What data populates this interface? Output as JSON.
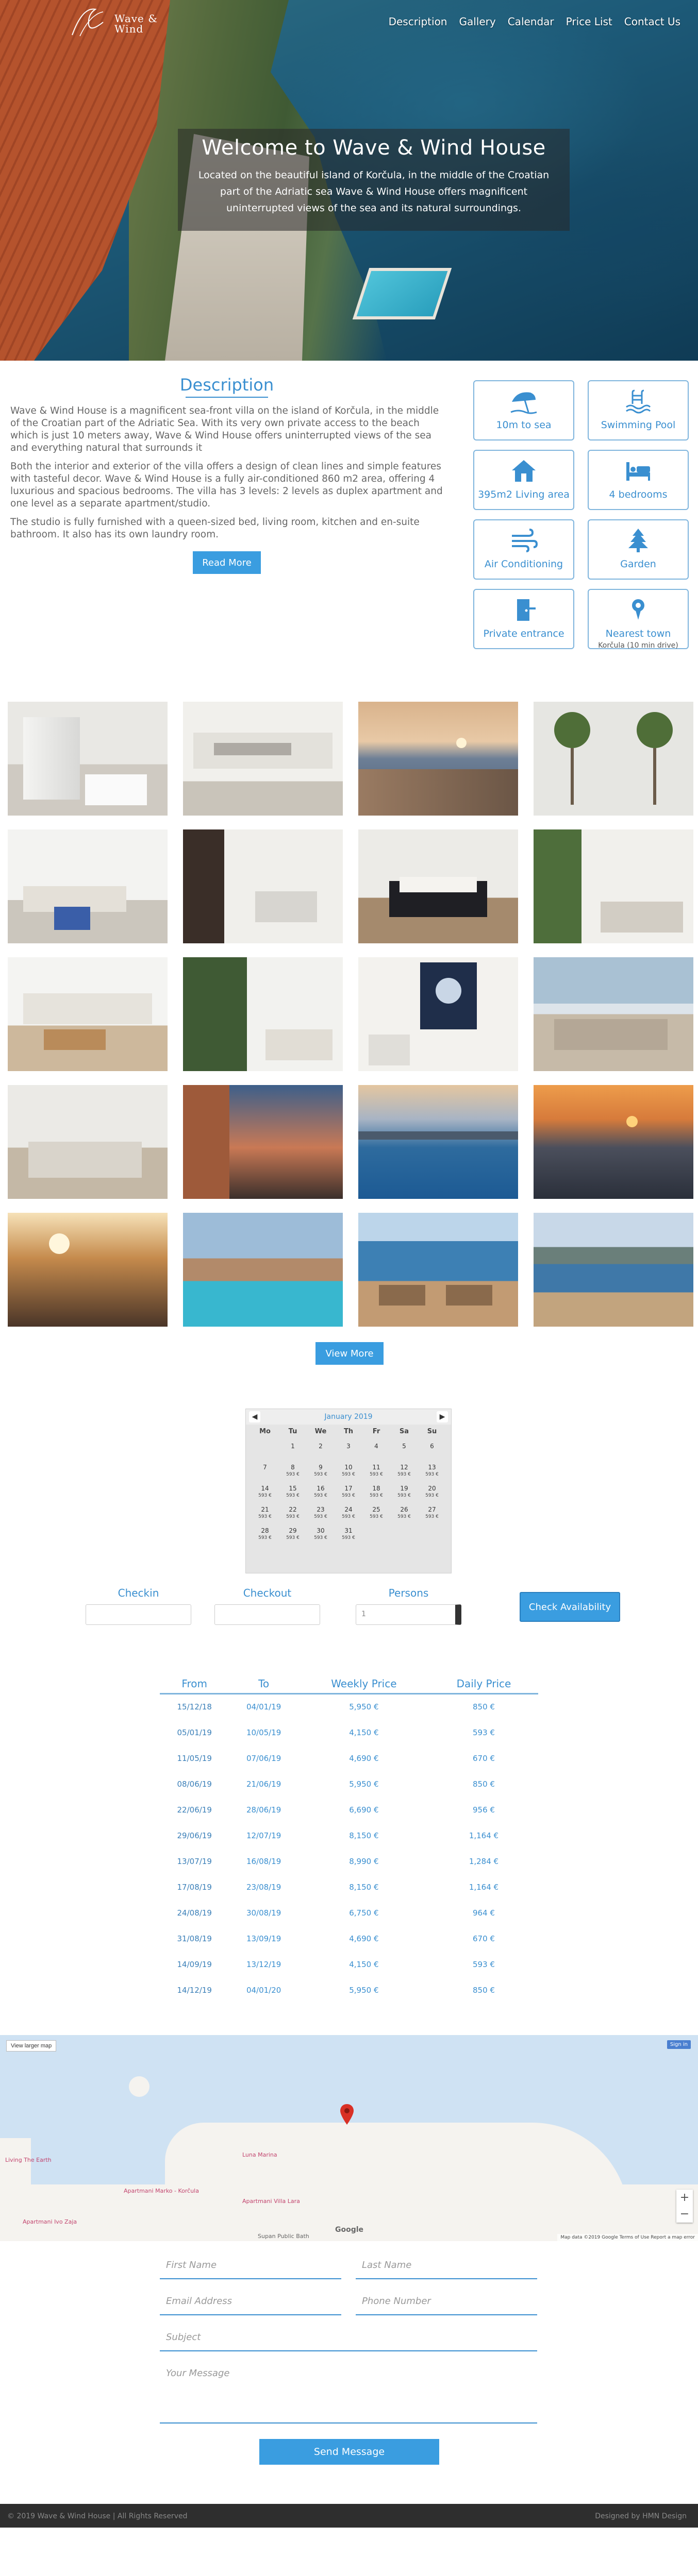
{
  "nav": {
    "logo_text_line1": "Wave &",
    "logo_text_line2": "Wind",
    "links": [
      "Description",
      "Gallery",
      "Calendar",
      "Price List",
      "Contact Us"
    ]
  },
  "hero": {
    "title": "Welcome to Wave & Wind House",
    "text": "Located on the beautiful island of Korčula, in the middle of the Croatian part of the Adriatic sea Wave & Wind House offers magnificent uninterrupted views of the sea and its natural surroundings."
  },
  "description": {
    "heading": "Description",
    "paragraphs": [
      "Wave & Wind House is a magnificent sea-front villa on the island of Korčula, in the middle of the Croatian part of the Adriatic Sea. With its very own private access to the beach which is just 10 meters away, Wave & Wind House offers uninterrupted views of the sea and everything natural that surrounds it",
      "Both the interior and exterior of the villa offers a design of clean lines and simple features with tasteful decor. Wave & Wind House is a fully air-conditioned 860 m2 area, offering 4 luxurious and spacious bedrooms. The villa has 3 levels: 2 levels as duplex apartment and one level as a separate apartment/studio.",
      "The studio is fully furnished with a queen-sized bed, living room, kitchen and en-suite bathroom. It also has its own laundry room."
    ],
    "read_more": "Read More"
  },
  "features": [
    {
      "icon": "umbrella-icon",
      "label": "10m to sea",
      "sub": ""
    },
    {
      "icon": "swimming-pool-icon",
      "label": "Swimming Pool",
      "sub": ""
    },
    {
      "icon": "house-icon",
      "label": "395m2 Living area",
      "sub": ""
    },
    {
      "icon": "bed-icon",
      "label": "4 bedrooms",
      "sub": ""
    },
    {
      "icon": "wind-icon",
      "label": "Air Conditioning",
      "sub": ""
    },
    {
      "icon": "tree-icon",
      "label": "Garden",
      "sub": ""
    },
    {
      "icon": "door-icon",
      "label": "Private entrance",
      "sub": ""
    },
    {
      "icon": "location-pin-icon",
      "label": "Nearest town",
      "sub": "Korčula (10 min drive)"
    }
  ],
  "gallery": {
    "view_more": "View More"
  },
  "calendar": {
    "month": "January 2019",
    "days_of_week": [
      "Mo",
      "Tu",
      "We",
      "Th",
      "Fr",
      "Sa",
      "Su"
    ],
    "weeks": [
      [
        {
          "d": ""
        },
        {
          "d": "1",
          "p": ""
        },
        {
          "d": "2",
          "p": ""
        },
        {
          "d": "3",
          "p": ""
        },
        {
          "d": "4",
          "p": ""
        },
        {
          "d": "5",
          "p": ""
        },
        {
          "d": "6",
          "p": ""
        }
      ],
      [
        {
          "d": "7",
          "p": ""
        },
        {
          "d": "8",
          "p": "593 €"
        },
        {
          "d": "9",
          "p": "593 €"
        },
        {
          "d": "10",
          "p": "593 €"
        },
        {
          "d": "11",
          "p": "593 €"
        },
        {
          "d": "12",
          "p": "593 €"
        },
        {
          "d": "13",
          "p": "593 €"
        }
      ],
      [
        {
          "d": "14",
          "p": "593 €"
        },
        {
          "d": "15",
          "p": "593 €"
        },
        {
          "d": "16",
          "p": "593 €"
        },
        {
          "d": "17",
          "p": "593 €"
        },
        {
          "d": "18",
          "p": "593 €"
        },
        {
          "d": "19",
          "p": "593 €"
        },
        {
          "d": "20",
          "p": "593 €"
        }
      ],
      [
        {
          "d": "21",
          "p": "593 €"
        },
        {
          "d": "22",
          "p": "593 €"
        },
        {
          "d": "23",
          "p": "593 €"
        },
        {
          "d": "24",
          "p": "593 €"
        },
        {
          "d": "25",
          "p": "593 €"
        },
        {
          "d": "26",
          "p": "593 €"
        },
        {
          "d": "27",
          "p": "593 €"
        }
      ],
      [
        {
          "d": "28",
          "p": "593 €"
        },
        {
          "d": "29",
          "p": "593 €"
        },
        {
          "d": "30",
          "p": "593 €"
        },
        {
          "d": "31",
          "p": "593 €"
        },
        {
          "d": ""
        },
        {
          "d": ""
        },
        {
          "d": ""
        }
      ]
    ]
  },
  "booking": {
    "checkin_label": "Checkin",
    "checkout_label": "Checkout",
    "persons_label": "Persons",
    "persons_value": "1",
    "button": "Check Availability"
  },
  "price_table": {
    "headers": [
      "From",
      "To",
      "Weekly Price",
      "Daily Price"
    ],
    "rows": [
      [
        "15/12/18",
        "04/01/19",
        "5,950 €",
        "850 €"
      ],
      [
        "05/01/19",
        "10/05/19",
        "4,150 €",
        "593 €"
      ],
      [
        "11/05/19",
        "07/06/19",
        "4,690 €",
        "670 €"
      ],
      [
        "08/06/19",
        "21/06/19",
        "5,950 €",
        "850 €"
      ],
      [
        "22/06/19",
        "28/06/19",
        "6,690 €",
        "956 €"
      ],
      [
        "29/06/19",
        "12/07/19",
        "8,150 €",
        "1,164 €"
      ],
      [
        "13/07/19",
        "16/08/19",
        "8,990 €",
        "1,284 €"
      ],
      [
        "17/08/19",
        "23/08/19",
        "8,150 €",
        "1,164 €"
      ],
      [
        "24/08/19",
        "30/08/19",
        "6,750 €",
        "964 €"
      ],
      [
        "31/08/19",
        "13/09/19",
        "4,690 €",
        "670 €"
      ],
      [
        "14/09/19",
        "13/12/19",
        "4,150 €",
        "593 €"
      ],
      [
        "14/12/19",
        "04/01/20",
        "5,950 €",
        "850 €"
      ]
    ]
  },
  "map": {
    "view_larger": "View larger map",
    "sign_in": "Sign in",
    "labels": [
      "Apartmani Ivo Zaja",
      "Apartmani Villa Lara",
      "Apartmani Marko - Korčula",
      "Supan Public Bath",
      "Luna Marina",
      "Living The Earth"
    ],
    "google": "Google",
    "footer": "Map data ©2019 Google   Terms of Use   Report a map error"
  },
  "contact": {
    "first_name": "First Name",
    "last_name": "Last Name",
    "email": "Email Address",
    "phone": "Phone Number",
    "subject": "Subject",
    "message": "Your Message",
    "send": "Send Message"
  },
  "footer": {
    "left": "© 2019 Wave & Wind House | All Rights Reserved",
    "right": "Designed by HMN Design"
  },
  "colors": {
    "accent": "#3a9de0",
    "accent_text": "#3a8fd0",
    "footer_bg": "#2e2e2e"
  }
}
